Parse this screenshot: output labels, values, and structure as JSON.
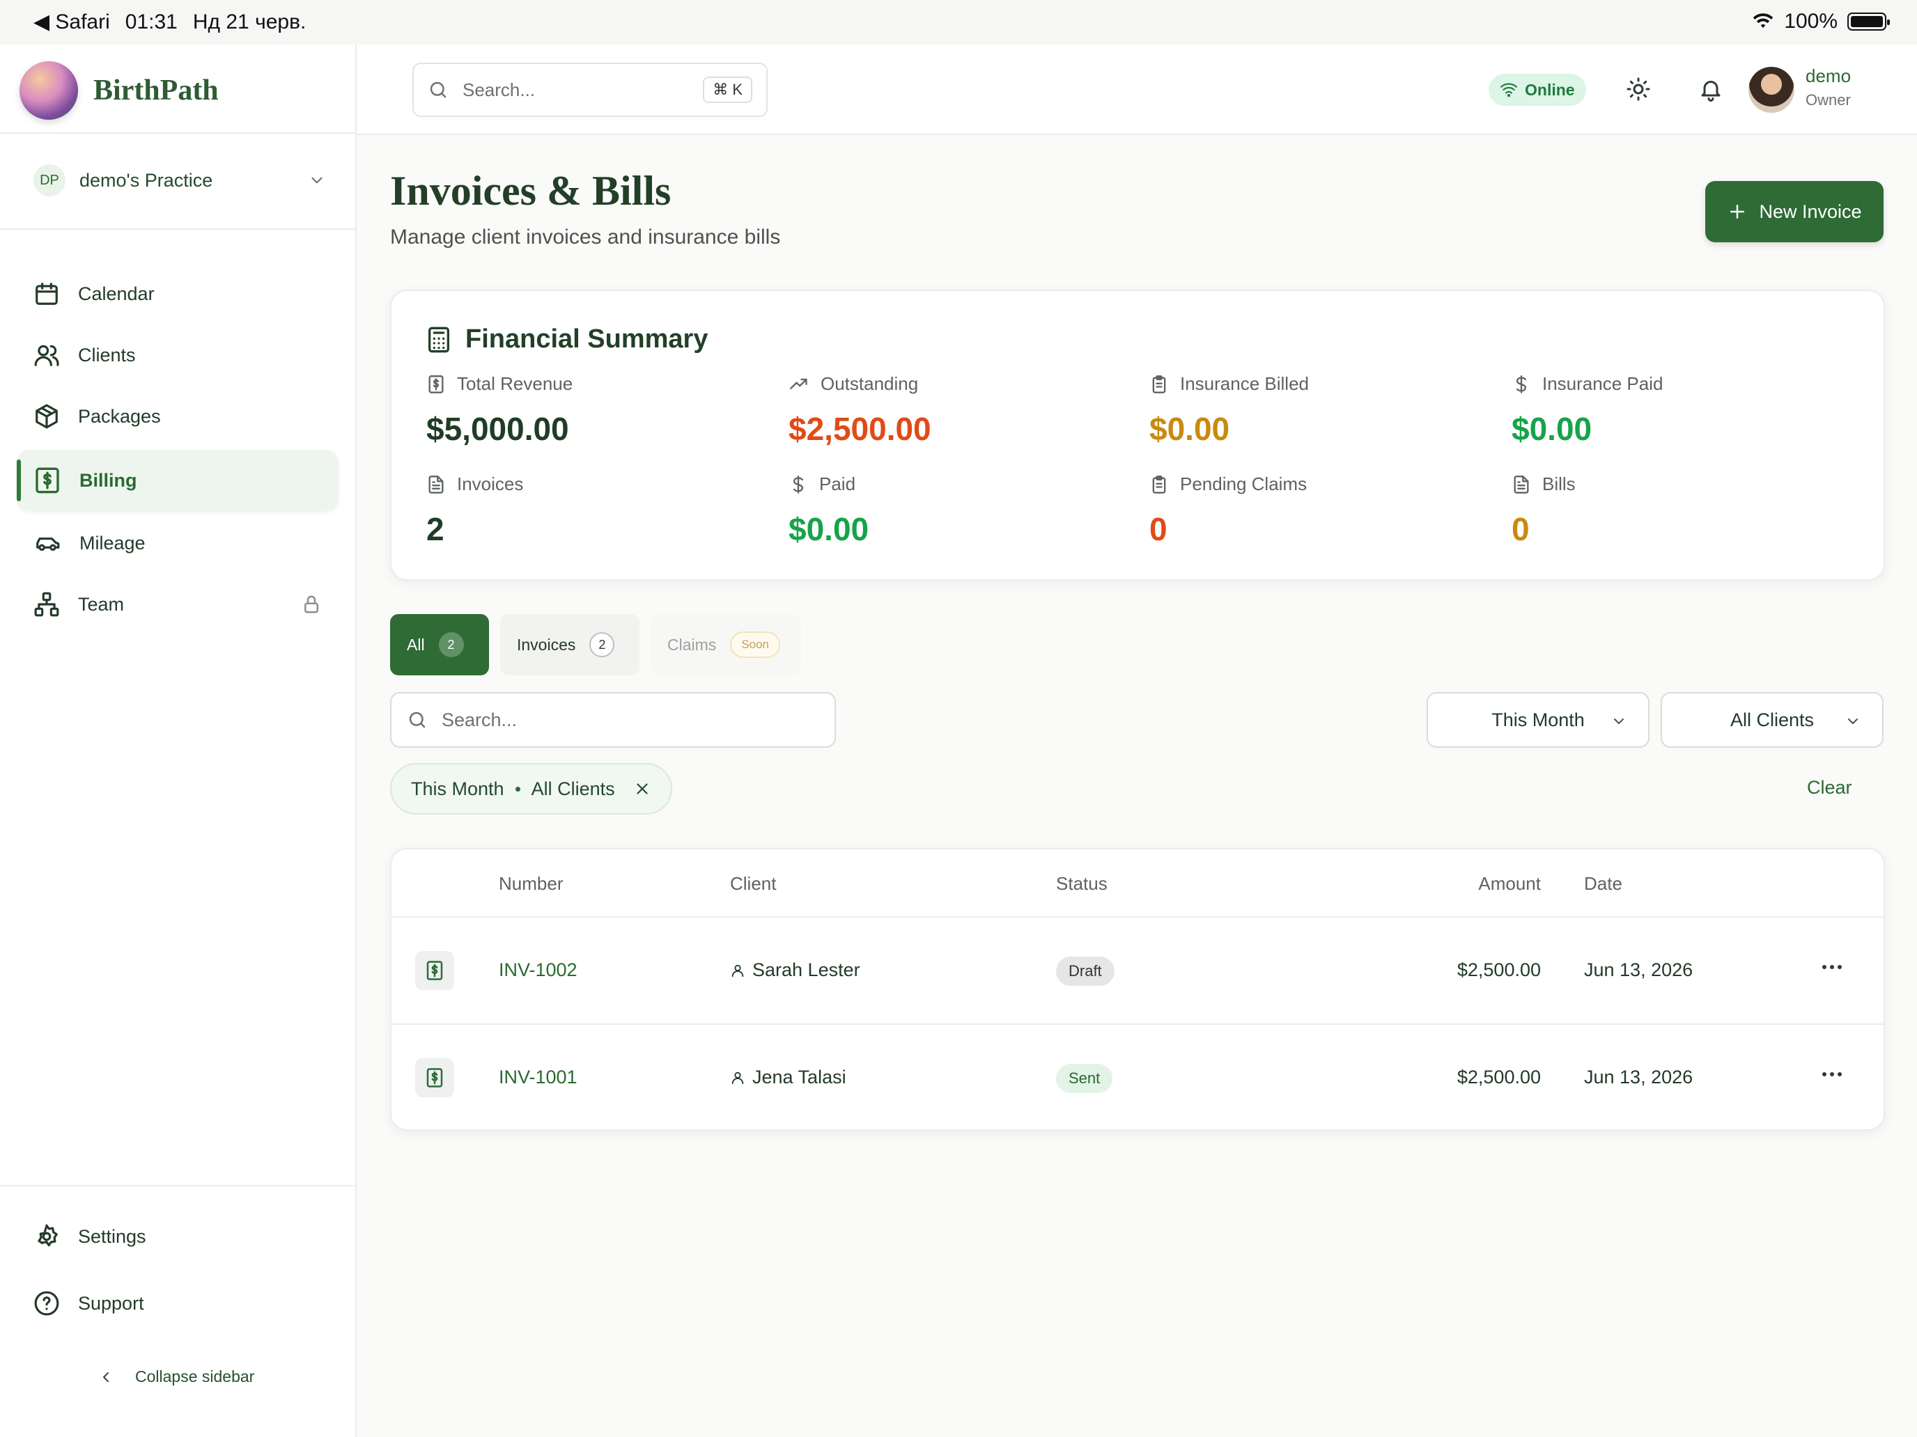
{
  "status_bar": {
    "app": "Safari",
    "time": "01:31",
    "date": "Нд 21 черв.",
    "battery": "100%"
  },
  "brand": {
    "name": "BirthPath"
  },
  "practice": {
    "initials": "DP",
    "name": "demo's Practice"
  },
  "nav": [
    {
      "label": "Calendar"
    },
    {
      "label": "Clients"
    },
    {
      "label": "Packages"
    },
    {
      "label": "Billing"
    },
    {
      "label": "Mileage"
    },
    {
      "label": "Team"
    }
  ],
  "sidebar_footer": {
    "settings": "Settings",
    "support": "Support",
    "collapse": "Collapse sidebar"
  },
  "topbar": {
    "search_placeholder": "Search...",
    "shortcut": "⌘ K",
    "online": "Online",
    "user_name": "demo",
    "user_role": "Owner"
  },
  "page": {
    "title": "Invoices & Bills",
    "subtitle": "Manage client invoices and insurance bills",
    "new_button": "New Invoice"
  },
  "summary": {
    "title": "Financial Summary",
    "stats": [
      {
        "label": "Total Revenue",
        "value": "$5,000.00",
        "color": "#1f3d25"
      },
      {
        "label": "Outstanding",
        "value": "$2,500.00",
        "color": "#e04b16"
      },
      {
        "label": "Insurance Billed",
        "value": "$0.00",
        "color": "#c98a10"
      },
      {
        "label": "Insurance Paid",
        "value": "$0.00",
        "color": "#16a34a"
      },
      {
        "label": "Invoices",
        "value": "2",
        "color": "#1f3d25"
      },
      {
        "label": "Paid",
        "value": "$0.00",
        "color": "#16a34a"
      },
      {
        "label": "Pending Claims",
        "value": "0",
        "color": "#e04b16"
      },
      {
        "label": "Bills",
        "value": "0",
        "color": "#c98a10"
      }
    ]
  },
  "tabs": [
    {
      "label": "All",
      "count": "2"
    },
    {
      "label": "Invoices",
      "count": "2"
    },
    {
      "label": "Claims",
      "badge": "Soon"
    }
  ],
  "filters": {
    "search_placeholder": "Search...",
    "period": "This Month",
    "client": "All Clients",
    "chip_period": "This Month",
    "chip_client": "All Clients",
    "clear": "Clear"
  },
  "table": {
    "headers": [
      "Number",
      "Client",
      "Status",
      "Amount",
      "Date"
    ],
    "rows": [
      {
        "number": "INV-1002",
        "client": "Sarah Lester",
        "status": "Draft",
        "amount": "$2,500.00",
        "date": "Jun 13, 2026"
      },
      {
        "number": "INV-1001",
        "client": "Jena Talasi",
        "status": "Sent",
        "amount": "$2,500.00",
        "date": "Jun 13, 2026"
      }
    ]
  },
  "colors": {
    "accent": "#2e6b35",
    "online_bg": "#dcf5e6"
  }
}
